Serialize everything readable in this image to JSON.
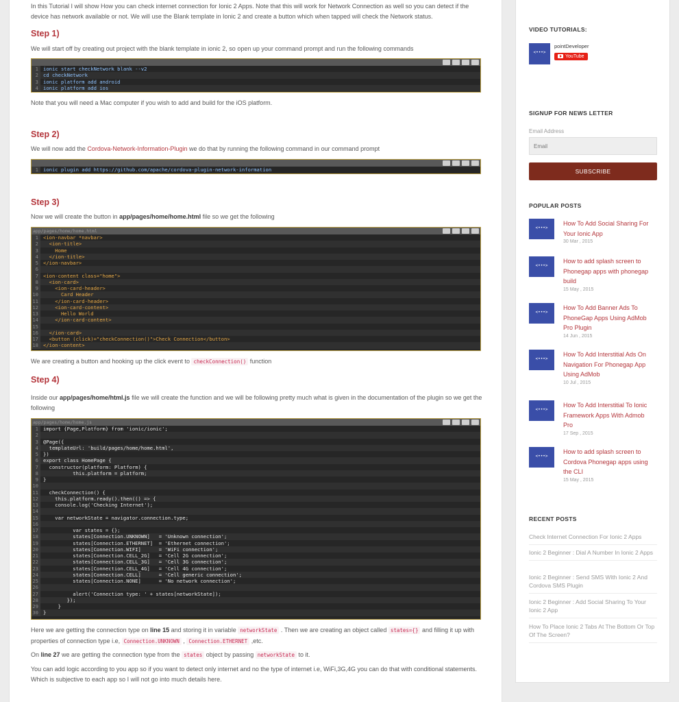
{
  "article": {
    "intro": "In this Tutorial I will show How you can check internet connection for Ionic 2 Apps. Note that this will work for Network Connection as well so you can detect if the device has network available or not. We will use the Blank template in Ionic 2 and create a button which when tapped will check the Network status.",
    "step1_title": "Step 1)",
    "step1_text": "We will start off by creating out project with the blank template in ionic 2, so open up your command prompt and run the following commands",
    "step1_note": "Note that you will need a Mac computer if you wish to add  and build for the iOS platform.",
    "step2_title": "Step 2)",
    "step2_text_a": "We will now add the ",
    "step2_link": "Cordova-Network-Information-Plugin",
    "step2_text_b": " we do that by running the following command in our command prompt",
    "step3_title": "Step 3)",
    "step3_text_a": "Now we will create the button in ",
    "step3_file": "app/pages/home/home.html",
    "step3_text_b": " file so we get the following",
    "step3_after_a": "We are creating a button and hooking up the click event to ",
    "step3_after_code": "checkConnection()",
    "step3_after_b": " function",
    "step4_title": "Step 4)",
    "step4_text_a": "Inside our ",
    "step4_file": "app/pages/home/html.js",
    "step4_text_b": " file we will create the function and we will be following pretty much what is given in the documentation of the plugin so we get the following",
    "explain1_a": "Here we are getting the connection type on ",
    "explain1_line": "line 15",
    "explain1_b": " and storing it in variable ",
    "explain1_code1": "networkState",
    "explain1_c": " . Then we are creating an object called ",
    "explain1_code2": "states={}",
    "explain1_d": " and filling it up with properties of connection type i.e, ",
    "explain1_code3": "Connection.UNKNOWN",
    "explain1_e": " , ",
    "explain1_code4": "Connection.ETHERNET",
    "explain1_f": " ,etc.",
    "explain2_a": "On ",
    "explain2_line": "line 27",
    "explain2_b": " we are getting the connection type from the ",
    "explain2_code1": "states",
    "explain2_c": " object by passing ",
    "explain2_code2": "networkState",
    "explain2_d": " to it.",
    "explain3": "You can add logic according to you app so if you want to detect only internet and no the type of internet i.e, WiFi,3G,4G you can do that with conditional statements. Which is subjective to each app so I will not go into much details here."
  },
  "code_blocks": {
    "block1": {
      "lines": [
        "ionic start checkNetwork blank --v2",
        "cd checkNetwork",
        "ionic platform add android",
        "ionic platform add ios"
      ]
    },
    "block2": {
      "lines": [
        "ionic plugin add https://github.com/apache/cordova-plugin-network-information"
      ]
    },
    "block3": {
      "filename": "app/pages/home/home.html",
      "lines": [
        "<ion-navbar *navbar>",
        "  <ion-title>",
        "    Home",
        "  </ion-title>",
        "</ion-navbar>",
        "",
        "<ion-content class=\"home\">",
        "  <ion-card>",
        "    <ion-card-header>",
        "      Card Header",
        "    </ion-card-header>",
        "    <ion-card-content>",
        "      Hello World",
        "    </ion-card-content>",
        "",
        "  </ion-card>",
        "  <button (click)=\"checkConnection()\">Check Connection</button>",
        "</ion-content>"
      ]
    },
    "block4": {
      "filename": "app/pages/home/home.js",
      "lines": [
        "import {Page,Platform} from 'ionic/ionic';",
        "",
        "@Page({",
        "  templateUrl: 'build/pages/home/home.html',",
        "})",
        "export class HomePage {",
        "  constructor(platform: Platform) {",
        "          this.platform = platform;",
        "}",
        "",
        "  checkConnection() {",
        "    this.platform.ready().then(() => {",
        "    console.log('Checking Internet');",
        "",
        "    var networkState = navigator.connection.type;",
        "",
        "          var states = {};",
        "          states[Connection.UNKNOWN]   = 'Unknown connection';",
        "          states[Connection.ETHERNET]  = 'Ethernet connection';",
        "          states[Connection.WIFI]      = 'WiFi connection';",
        "          states[Connection.CELL_2G]   = 'Cell 2G connection';",
        "          states[Connection.CELL_3G]   = 'Cell 3G connection';",
        "          states[Connection.CELL_4G]   = 'Cell 4G connection';",
        "          states[Connection.CELL]      = 'Cell generic connection';",
        "          states[Connection.NONE]      = 'No network connection';",
        "",
        "          alert('Connection type: ' + states[networkState]);",
        "        });",
        "     }",
        "}"
      ]
    }
  },
  "sidebar": {
    "video": {
      "heading": "VIDEO TUTORIALS:",
      "channel": "pointDeveloper",
      "youtube_label": "YouTube"
    },
    "newsletter": {
      "heading": "SIGNUP FOR NEWS LETTER",
      "email_label": "Email Address",
      "email_placeholder": "Email",
      "subscribe_label": "SUBSCRIBE"
    },
    "popular": {
      "heading": "POPULAR POSTS",
      "posts": [
        {
          "title": "How To Add Social Sharing For Your Ionic App",
          "date": "30 Mar , 2015"
        },
        {
          "title": "How to add splash screen to Phonegap apps with phonegap build",
          "date": "15 May , 2015"
        },
        {
          "title": "How To Add Banner Ads To PhoneGap Apps Using AdMob Pro Plugin",
          "date": "14 Jun , 2015"
        },
        {
          "title": "How To Add Interstitial Ads On Navigation For Phonegap App Using AdMob",
          "date": "10 Jul , 2015"
        },
        {
          "title": "How To Add Interstitial To Ionic Framework Apps With Admob Pro",
          "date": "17 Sep , 2015"
        },
        {
          "title": "How to add splash screen to Cordova Phonegap apps using the CLI",
          "date": "15 May , 2015"
        }
      ]
    },
    "recent": {
      "heading": "RECENT POSTS",
      "posts": [
        "Check Internet Connection For Ionic 2 Apps",
        "Ionic 2 Beginner : Dial A Number In Ionic 2 Apps",
        "Ionic 2 Beginner : Send SMS With Ionic 2 And Cordova SMS Plugin",
        "Ionic 2 Beginner : Add Social Sharing To Your Ionic 2 App",
        "How To Place Ionic 2 Tabs At The Bottom Or Top Of The Screen?"
      ]
    }
  },
  "colors": {
    "accent": "#b3343a",
    "subscribe": "#7e2b1d",
    "code_bg": "#262626",
    "thumb": "#3a4ea8",
    "youtube": "#e62117"
  }
}
